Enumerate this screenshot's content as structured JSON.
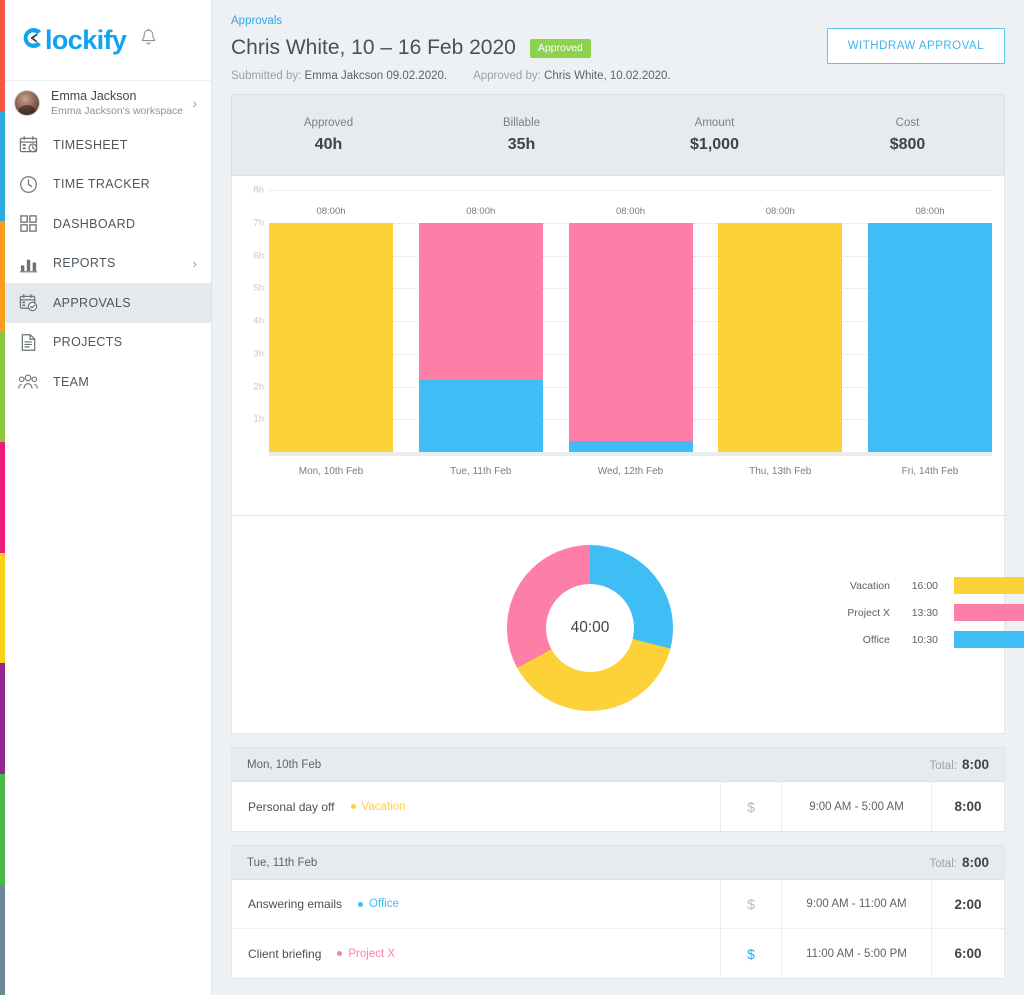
{
  "brand": {
    "logo_text": "lockify",
    "logo_initial": "C",
    "bell_icon": "bell-icon"
  },
  "sidebar": {
    "color_strip": [
      "#f4563f",
      "#29abe2",
      "#f99d1c",
      "#8cc63e",
      "#ec1e79",
      "#fbd117",
      "#92278f",
      "#4cb848",
      "#6d8794"
    ],
    "user": {
      "name": "Emma Jackson",
      "workspace": "Emma Jackson's workspace",
      "chevron": "›"
    },
    "items": [
      {
        "label": "TIMESHEET",
        "icon": "timesheet-icon",
        "active": false,
        "chevron": ""
      },
      {
        "label": "TIME TRACKER",
        "icon": "clock-icon",
        "active": false,
        "chevron": ""
      },
      {
        "label": "DASHBOARD",
        "icon": "dashboard-icon",
        "active": false,
        "chevron": ""
      },
      {
        "label": "REPORTS",
        "icon": "reports-icon",
        "active": false,
        "chevron": "›"
      },
      {
        "label": "APPROVALS",
        "icon": "approvals-icon",
        "active": true,
        "chevron": ""
      },
      {
        "label": "PROJECTS",
        "icon": "projects-icon",
        "active": false,
        "chevron": ""
      },
      {
        "label": "TEAM",
        "icon": "team-icon",
        "active": false,
        "chevron": ""
      }
    ]
  },
  "header": {
    "breadcrumb": "Approvals",
    "title": "Chris White, 10 – 16 Feb 2020",
    "status_badge": "Approved",
    "status_color": "#8dd24f",
    "submitted_label": "Submitted by:",
    "submitted_value": "Emma Jakcson 09.02.2020.",
    "approved_label": "Approved by:",
    "approved_value": "Chris White, 10.02.2020.",
    "withdraw_button": "WITHDRAW APPROVAL"
  },
  "summary": [
    {
      "label": "Approved",
      "value": "40h"
    },
    {
      "label": "Billable",
      "value": "35h"
    },
    {
      "label": "Amount",
      "value": "$1,000"
    },
    {
      "label": "Cost",
      "value": "$800"
    }
  ],
  "colors": {
    "vacation": "#fcd238",
    "project_x": "#fd7fa7",
    "office": "#3fbdf5",
    "accent": "#2fa8e8",
    "track": "#f1f2f3"
  },
  "chart_data": [
    {
      "type": "bar",
      "stacked": true,
      "title": "",
      "xlabel": "",
      "ylabel": "",
      "ylim": [
        0,
        8
      ],
      "grid": true,
      "ytick_labels": [
        "1h",
        "2h",
        "3h",
        "4h",
        "5h",
        "6h",
        "7h",
        "8h"
      ],
      "yticks": [
        1,
        2,
        3,
        4,
        5,
        6,
        7,
        8
      ],
      "categories": [
        "Mon, 10th Feb",
        "Tue, 11th Feb",
        "Wed, 12th Feb",
        "Thu, 13th Feb",
        "Fri, 14th Feb"
      ],
      "bar_labels": [
        "08:00h",
        "08:00h",
        "08:00h",
        "08:00h",
        "08:00h"
      ],
      "series": [
        {
          "name": "Office",
          "color": "#3fbdf5",
          "values": [
            0,
            2.2,
            0.33,
            0,
            7
          ]
        },
        {
          "name": "Project X",
          "color": "#fd7fa7",
          "values": [
            0,
            4.8,
            6.67,
            0,
            0
          ]
        },
        {
          "name": "Vacation",
          "color": "#fcd238",
          "values": [
            7,
            0,
            0,
            7,
            0
          ]
        }
      ],
      "legend_position": "none"
    },
    {
      "type": "pie",
      "variant": "donut",
      "title": "",
      "center_label": "40:00",
      "start_angle": 0,
      "labels": [
        "Office",
        "Vacation",
        "Project X"
      ],
      "values": [
        29,
        38,
        33
      ],
      "colors": [
        "#3fbdf5",
        "#fcd238",
        "#fd7fa7"
      ],
      "legend_position": "right",
      "legend_rows": [
        {
          "name": "Vacation",
          "time": "16:00",
          "pct": "38%",
          "pct_value": 38,
          "color": "#fcd238"
        },
        {
          "name": "Project X",
          "time": "13:30",
          "pct": "33%",
          "pct_value": 33,
          "color": "#fd7fa7"
        },
        {
          "name": "Office",
          "time": "10:30",
          "pct": "29%",
          "pct_value": 29,
          "color": "#3fbdf5"
        }
      ]
    }
  ],
  "days": [
    {
      "date": "Mon, 10th Feb",
      "total_label": "Total:",
      "total": "8:00",
      "entries": [
        {
          "description": "Personal day off",
          "project": "Vacation",
          "project_color": "#fcd238",
          "billable": false,
          "billable_icon": "dollar-icon",
          "time_range": "9:00 AM - 5:00 AM",
          "duration": "8:00"
        }
      ]
    },
    {
      "date": "Tue, 11th Feb",
      "total_label": "Total:",
      "total": "8:00",
      "entries": [
        {
          "description": "Answering emails",
          "project": "Office",
          "project_color": "#3fbdf5",
          "billable": false,
          "billable_icon": "dollar-icon",
          "time_range": "9:00 AM - 11:00 AM",
          "duration": "2:00"
        },
        {
          "description": "Client briefing",
          "project": "Project X",
          "project_color": "#fd7fa7",
          "billable": true,
          "billable_icon": "dollar-icon",
          "time_range": "11:00 AM - 5:00 PM",
          "duration": "6:00"
        }
      ]
    }
  ]
}
